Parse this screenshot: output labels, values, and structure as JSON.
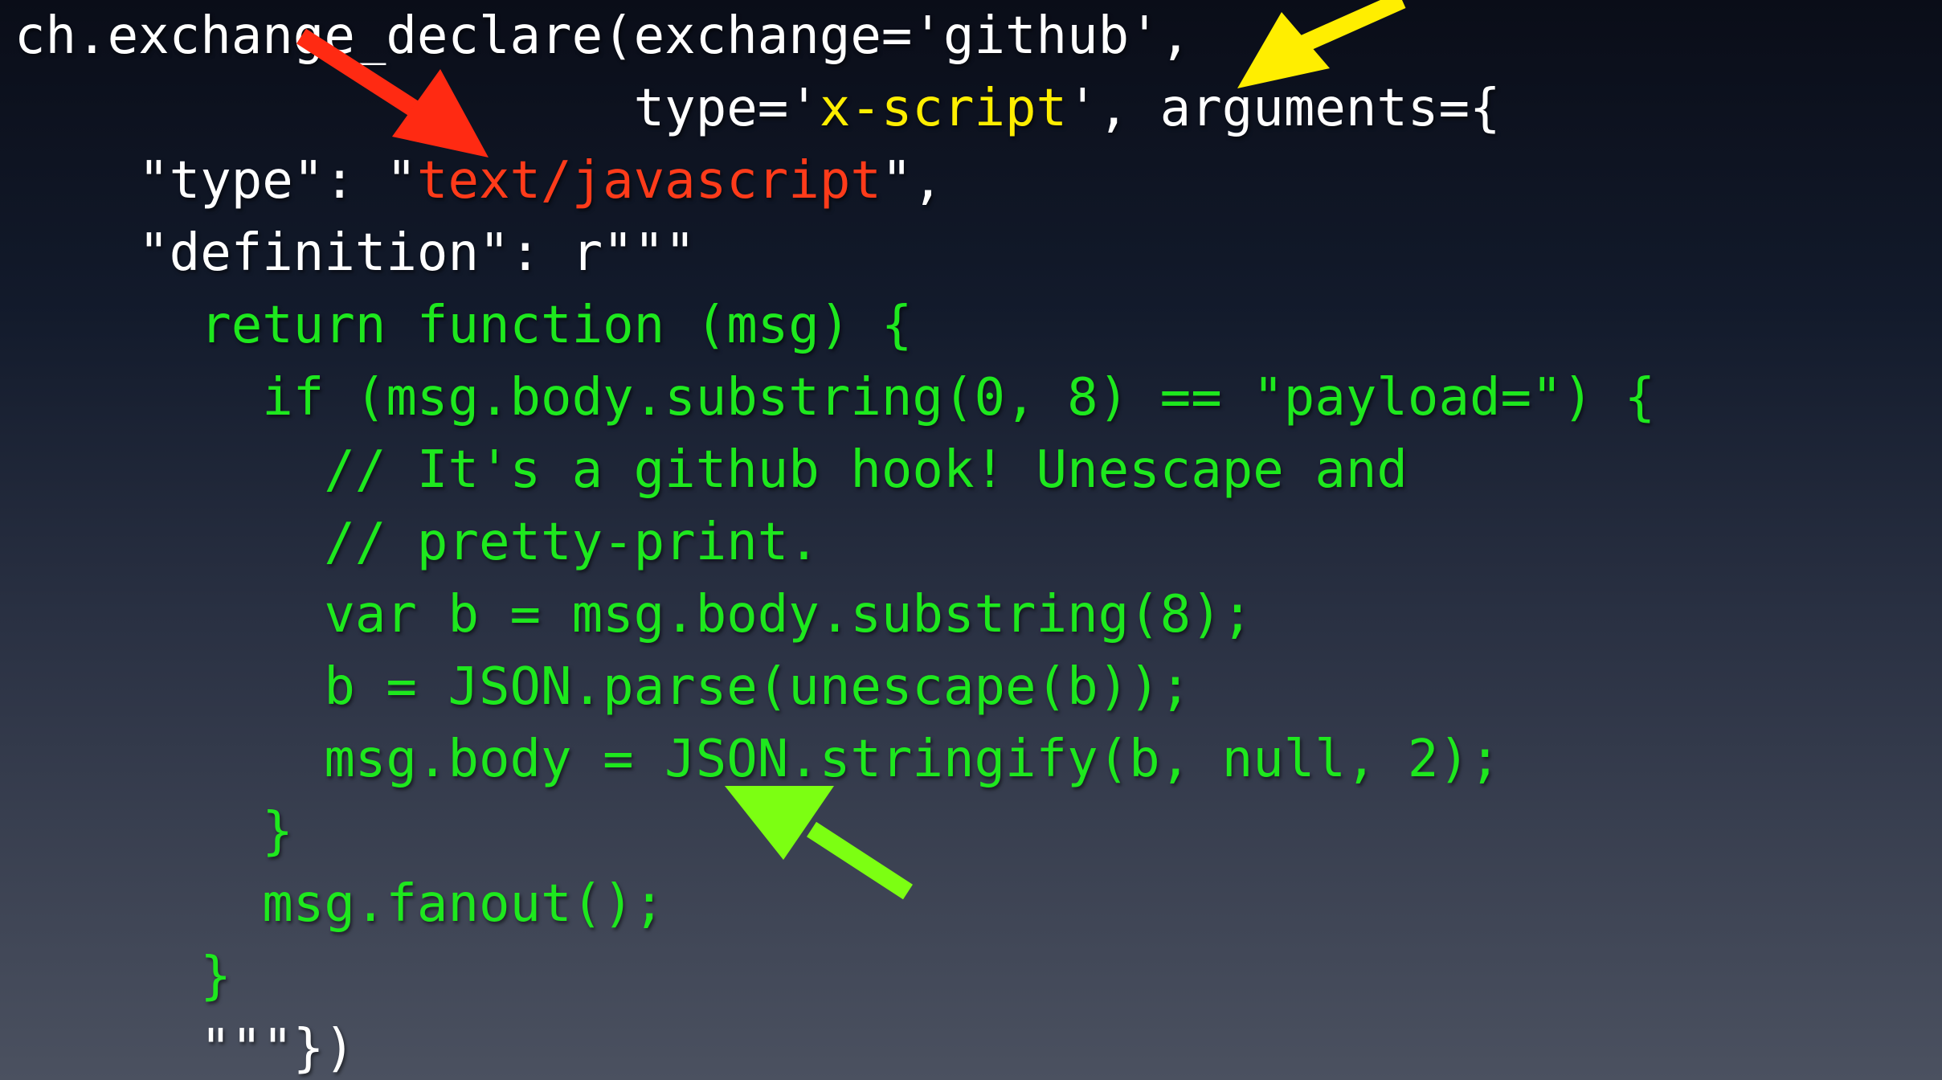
{
  "slide": {
    "code_lines": [
      {
        "segments": [
          {
            "text": "ch.exchange_declare(exchange='github',",
            "color": "white"
          }
        ]
      },
      {
        "segments": [
          {
            "text": "                    type='",
            "color": "white"
          },
          {
            "text": "x-script",
            "color": "yellow"
          },
          {
            "text": "', arguments={",
            "color": "white"
          }
        ]
      },
      {
        "segments": [
          {
            "text": "    \"type\": \"",
            "color": "white"
          },
          {
            "text": "text/javascript",
            "color": "red"
          },
          {
            "text": "\",",
            "color": "white"
          }
        ]
      },
      {
        "segments": [
          {
            "text": "    \"definition\": r\"\"\"",
            "color": "white"
          }
        ]
      },
      {
        "segments": [
          {
            "text": "      return function (msg) {",
            "color": "green"
          }
        ]
      },
      {
        "segments": [
          {
            "text": "        if (msg.body.substring(0, 8) == \"payload=\") {",
            "color": "green"
          }
        ]
      },
      {
        "segments": [
          {
            "text": "          // It's a github hook! Unescape and",
            "color": "green"
          }
        ]
      },
      {
        "segments": [
          {
            "text": "          // pretty-print.",
            "color": "green"
          }
        ]
      },
      {
        "segments": [
          {
            "text": "          var b = msg.body.substring(8);",
            "color": "green"
          }
        ]
      },
      {
        "segments": [
          {
            "text": "          b = JSON.parse(unescape(b));",
            "color": "green"
          }
        ]
      },
      {
        "segments": [
          {
            "text": "          msg.body = JSON.stringify(b, null, 2);",
            "color": "green"
          }
        ]
      },
      {
        "segments": [
          {
            "text": "        }",
            "color": "green"
          }
        ]
      },
      {
        "segments": [
          {
            "text": "        msg.fanout();",
            "color": "green"
          }
        ]
      },
      {
        "segments": [
          {
            "text": "      }",
            "color": "green"
          }
        ]
      },
      {
        "segments": [
          {
            "text": "      \"\"\"})",
            "color": "white"
          }
        ]
      }
    ]
  },
  "colors": {
    "white": "#ffffff",
    "red": "#ff3b1a",
    "yellow": "#ffee00",
    "green": "#1ee81e",
    "arrow_red": "#ff2a12",
    "arrow_yellow": "#ffee00",
    "arrow_green": "#7cff12"
  },
  "arrows": [
    {
      "name": "red-arrow",
      "color": "arrow_red"
    },
    {
      "name": "yellow-arrow",
      "color": "arrow_yellow"
    },
    {
      "name": "green-arrow",
      "color": "arrow_green"
    }
  ]
}
